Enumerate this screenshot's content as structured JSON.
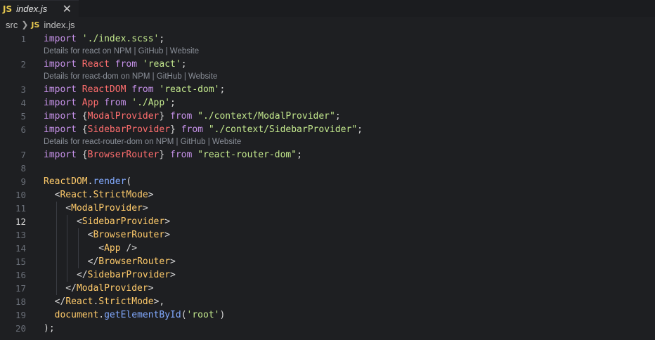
{
  "tab": {
    "icon": "JS",
    "title": "index.js",
    "close": "✕"
  },
  "breadcrumb": {
    "folder": "src",
    "icon": "JS",
    "file": "index.js"
  },
  "codelens": {
    "react": "Details for react on NPM | GitHub | Website",
    "react_dom": "Details for react-dom on NPM | GitHub | Website",
    "react_router_dom": "Details for react-router-dom on NPM | GitHub | Website"
  },
  "active_line": 12,
  "lines": [
    {
      "n": "1",
      "tokens": [
        [
          "kw",
          "import"
        ],
        [
          "punct",
          " "
        ],
        [
          "str",
          "'./index.scss'"
        ],
        [
          "punct",
          ";"
        ]
      ]
    },
    {
      "n": "2",
      "tokens": [
        [
          "kw",
          "import"
        ],
        [
          "punct",
          " "
        ],
        [
          "var",
          "React"
        ],
        [
          "punct",
          " "
        ],
        [
          "kw",
          "from"
        ],
        [
          "punct",
          " "
        ],
        [
          "str",
          "'react'"
        ],
        [
          "punct",
          ";"
        ]
      ]
    },
    {
      "n": "3",
      "tokens": [
        [
          "kw",
          "import"
        ],
        [
          "punct",
          " "
        ],
        [
          "var",
          "ReactDOM"
        ],
        [
          "punct",
          " "
        ],
        [
          "kw",
          "from"
        ],
        [
          "punct",
          " "
        ],
        [
          "str",
          "'react-dom'"
        ],
        [
          "punct",
          ";"
        ]
      ]
    },
    {
      "n": "4",
      "tokens": [
        [
          "kw",
          "import"
        ],
        [
          "punct",
          " "
        ],
        [
          "var",
          "App"
        ],
        [
          "punct",
          " "
        ],
        [
          "kw",
          "from"
        ],
        [
          "punct",
          " "
        ],
        [
          "str",
          "'./App'"
        ],
        [
          "punct",
          ";"
        ]
      ]
    },
    {
      "n": "5",
      "tokens": [
        [
          "kw",
          "import"
        ],
        [
          "punct",
          " {"
        ],
        [
          "var",
          "ModalProvider"
        ],
        [
          "punct",
          "} "
        ],
        [
          "kw",
          "from"
        ],
        [
          "punct",
          " "
        ],
        [
          "str",
          "\"./context/ModalProvider\""
        ],
        [
          "punct",
          ";"
        ]
      ]
    },
    {
      "n": "6",
      "tokens": [
        [
          "kw",
          "import"
        ],
        [
          "punct",
          " {"
        ],
        [
          "var",
          "SidebarProvider"
        ],
        [
          "punct",
          "} "
        ],
        [
          "kw",
          "from"
        ],
        [
          "punct",
          " "
        ],
        [
          "str",
          "\"./context/SidebarProvider\""
        ],
        [
          "punct",
          ";"
        ]
      ]
    },
    {
      "n": "7",
      "tokens": [
        [
          "kw",
          "import"
        ],
        [
          "punct",
          " {"
        ],
        [
          "var",
          "BrowserRouter"
        ],
        [
          "punct",
          "} "
        ],
        [
          "kw",
          "from"
        ],
        [
          "punct",
          " "
        ],
        [
          "str",
          "\"react-router-dom\""
        ],
        [
          "punct",
          ";"
        ]
      ]
    },
    {
      "n": "8",
      "tokens": []
    },
    {
      "n": "9",
      "tokens": [
        [
          "obj",
          "ReactDOM"
        ],
        [
          "punct",
          "."
        ],
        [
          "fn",
          "render"
        ],
        [
          "punct",
          "("
        ]
      ]
    },
    {
      "n": "10",
      "tokens": [
        [
          "punct",
          "  <"
        ],
        [
          "obj",
          "React"
        ],
        [
          "punct",
          "."
        ],
        [
          "obj",
          "StrictMode"
        ],
        [
          "punct",
          ">"
        ]
      ]
    },
    {
      "n": "11",
      "tokens": [
        [
          "punct",
          "    <"
        ],
        [
          "obj",
          "ModalProvider"
        ],
        [
          "punct",
          ">"
        ]
      ]
    },
    {
      "n": "12",
      "tokens": [
        [
          "punct",
          "      <"
        ],
        [
          "obj",
          "SidebarProvider"
        ],
        [
          "punct",
          ">"
        ]
      ]
    },
    {
      "n": "13",
      "tokens": [
        [
          "punct",
          "        <"
        ],
        [
          "obj",
          "BrowserRouter"
        ],
        [
          "punct",
          ">"
        ]
      ]
    },
    {
      "n": "14",
      "tokens": [
        [
          "punct",
          "          <"
        ],
        [
          "obj",
          "App"
        ],
        [
          "punct",
          " />"
        ]
      ]
    },
    {
      "n": "15",
      "tokens": [
        [
          "punct",
          "        </"
        ],
        [
          "obj",
          "BrowserRouter"
        ],
        [
          "punct",
          ">"
        ]
      ]
    },
    {
      "n": "16",
      "tokens": [
        [
          "punct",
          "      </"
        ],
        [
          "obj",
          "SidebarProvider"
        ],
        [
          "punct",
          ">"
        ]
      ]
    },
    {
      "n": "17",
      "tokens": [
        [
          "punct",
          "    </"
        ],
        [
          "obj",
          "ModalProvider"
        ],
        [
          "punct",
          ">"
        ]
      ]
    },
    {
      "n": "18",
      "tokens": [
        [
          "punct",
          "  </"
        ],
        [
          "obj",
          "React"
        ],
        [
          "punct",
          "."
        ],
        [
          "obj",
          "StrictMode"
        ],
        [
          "punct",
          ">,"
        ]
      ]
    },
    {
      "n": "19",
      "tokens": [
        [
          "punct",
          "  "
        ],
        [
          "obj",
          "document"
        ],
        [
          "punct",
          "."
        ],
        [
          "fn",
          "getElementById"
        ],
        [
          "punct",
          "("
        ],
        [
          "str",
          "'root'"
        ],
        [
          "punct",
          ")"
        ]
      ]
    },
    {
      "n": "20",
      "tokens": [
        [
          "punct",
          ");"
        ]
      ]
    }
  ]
}
